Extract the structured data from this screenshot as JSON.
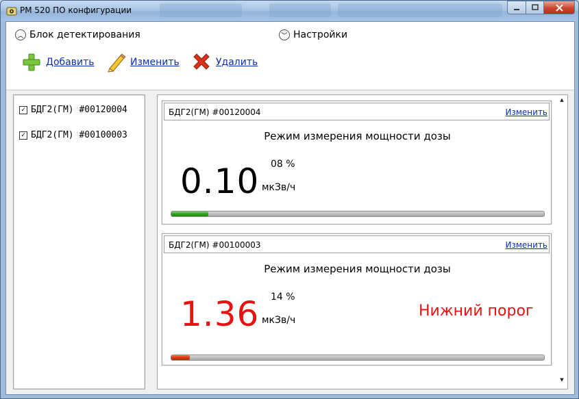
{
  "window": {
    "title": "РМ 520 ПО конфигурации",
    "minimize_icon": "minimize-icon",
    "maximize_icon": "maximize-icon",
    "close_icon": "close-icon"
  },
  "ribbon": {
    "section_detect": "Блок детектирования",
    "section_settings": "Настройки",
    "add_label": "Добавить",
    "edit_label": "Изменить",
    "delete_label": "Удалить"
  },
  "tree": {
    "items": [
      {
        "label": "БДГ2(ГМ) #00120004",
        "checked": true
      },
      {
        "label": "БДГ2(ГМ) #00100003",
        "checked": true
      }
    ]
  },
  "cards": [
    {
      "name": "БДГ2(ГМ) #00120004",
      "edit_label": "Изменить",
      "mode": "Режим измерения мощности дозы",
      "value": "0.10",
      "value_color": "#000000",
      "percent": "08 %",
      "unit": "мкЗв/ч",
      "warning": "",
      "progress": 0.1,
      "progress_color": "green"
    },
    {
      "name": "БДГ2(ГМ) #00100003",
      "edit_label": "Изменить",
      "mode": "Режим измерения мощности дозы",
      "value": "1.36",
      "value_color": "#e81212",
      "percent": "14 %",
      "unit": "мкЗв/ч",
      "warning": "Нижний порог",
      "progress": 0.05,
      "progress_color": "red"
    }
  ]
}
